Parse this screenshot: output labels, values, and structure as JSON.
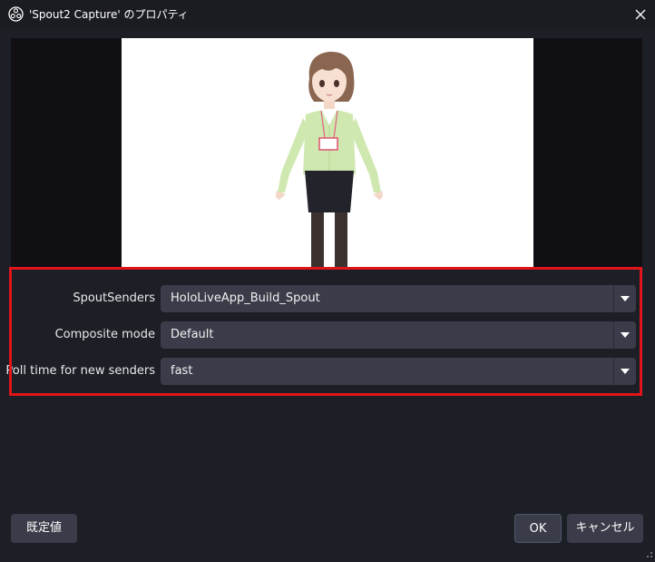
{
  "window": {
    "title": "'Spout2 Capture' のプロパティ",
    "app_icon": "obs-logo-icon",
    "close_icon": "close-icon"
  },
  "preview": {
    "content": "3d-avatar-character-image",
    "background_color": "#ffffff"
  },
  "properties": [
    {
      "label": "SpoutSenders",
      "value": "HoloLiveApp_Build_Spout"
    },
    {
      "label": "Composite mode",
      "value": "Default"
    },
    {
      "label": "Poll time for new senders",
      "value": "fast"
    }
  ],
  "highlight_color": "#e0141b",
  "buttons": {
    "defaults": "既定値",
    "ok": "OK",
    "cancel": "キャンセル"
  }
}
